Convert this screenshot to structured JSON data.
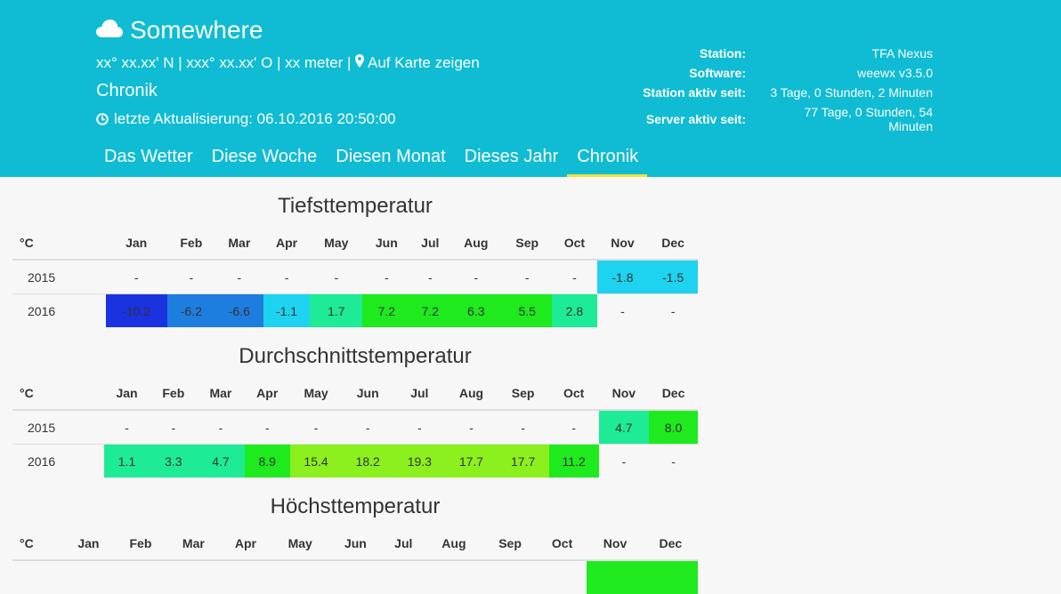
{
  "header": {
    "site_name": "Somewhere",
    "location": "xx° xx.xx' N | xxx° xx.xx' O | xx meter |",
    "map_link": "Auf Karte zeigen",
    "page_title": "Chronik",
    "last_update": "letzte Aktualisierung: 06.10.2016 20:50:00",
    "icons": {
      "site": "cloud-icon",
      "map": "map-marker-icon",
      "update": "clock-icon"
    }
  },
  "station_info": [
    {
      "label": "Station:",
      "value": "TFA Nexus"
    },
    {
      "label": "Software:",
      "value": "weewx v3.5.0"
    },
    {
      "label": "Station aktiv seit:",
      "value": "3 Tage, 0 Stunden, 2 Minuten"
    },
    {
      "label": "Server aktiv seit:",
      "value": "77 Tage, 0 Stunden, 54 Minuten"
    }
  ],
  "nav": {
    "tabs": [
      "Das Wetter",
      "Diese Woche",
      "Diesen Monat",
      "Dieses Jahr",
      "Chronik"
    ],
    "active": "Chronik"
  },
  "colors": {
    "header_bg": "#0fbcd4",
    "active_tab_underline": "#f3e33c",
    "temp_scale": {
      "-10.2": "#1a32e0",
      "-6": "#1e7ee0",
      "-2": "#1ed3ef",
      "2": "#1eeb96",
      "6": "#1eea1e",
      "15": "#8cf01e"
    }
  },
  "tables": [
    {
      "title": "Tiefsttemperatur",
      "unit": "°C",
      "months": [
        "Jan",
        "Feb",
        "Mar",
        "Apr",
        "May",
        "Jun",
        "Jul",
        "Aug",
        "Sep",
        "Oct",
        "Nov",
        "Dec"
      ],
      "rows": [
        {
          "year": "2015",
          "values": [
            "-",
            "-",
            "-",
            "-",
            "-",
            "-",
            "-",
            "-",
            "-",
            "-",
            "-1.8",
            "-1.5"
          ],
          "colors": [
            "",
            "",
            "",
            "",
            "",
            "",
            "",
            "",
            "",
            "",
            "#1ed3ef",
            "#1ed3ef"
          ]
        },
        {
          "year": "2016",
          "values": [
            "-10.2",
            "-6.2",
            "-6.6",
            "-1.1",
            "1.7",
            "7.2",
            "7.2",
            "6.3",
            "5.5",
            "2.8",
            "-",
            "-"
          ],
          "colors": [
            "#1a32e0",
            "#1e7ee0",
            "#1e7ee0",
            "#1ed3ef",
            "#1eeb96",
            "#1eea1e",
            "#1eea1e",
            "#1eea1e",
            "#1eea1e",
            "#1eeb96",
            "",
            ""
          ]
        }
      ]
    },
    {
      "title": "Durchschnittstemperatur",
      "unit": "°C",
      "months": [
        "Jan",
        "Feb",
        "Mar",
        "Apr",
        "May",
        "Jun",
        "Jul",
        "Aug",
        "Sep",
        "Oct",
        "Nov",
        "Dec"
      ],
      "rows": [
        {
          "year": "2015",
          "values": [
            "-",
            "-",
            "-",
            "-",
            "-",
            "-",
            "-",
            "-",
            "-",
            "-",
            "4.7",
            "8.0"
          ],
          "colors": [
            "",
            "",
            "",
            "",
            "",
            "",
            "",
            "",
            "",
            "",
            "#1eeb96",
            "#1eea1e"
          ]
        },
        {
          "year": "2016",
          "values": [
            "1.1",
            "3.3",
            "4.7",
            "8.9",
            "15.4",
            "18.2",
            "19.3",
            "17.7",
            "17.7",
            "11.2",
            "-",
            "-"
          ],
          "colors": [
            "#1eeb96",
            "#1eeb96",
            "#1eeb96",
            "#1eea1e",
            "#8cf01e",
            "#8cf01e",
            "#8cf01e",
            "#8cf01e",
            "#8cf01e",
            "#1eea1e",
            "",
            ""
          ]
        }
      ]
    },
    {
      "title": "Höchsttemperatur",
      "unit": "°C",
      "months": [
        "Jan",
        "Feb",
        "Mar",
        "Apr",
        "May",
        "Jun",
        "Jul",
        "Aug",
        "Sep",
        "Oct",
        "Nov",
        "Dec"
      ],
      "rows": [
        {
          "year": "",
          "values": [
            "",
            "",
            "",
            "",
            "",
            "",
            "",
            "",
            "",
            "",
            "",
            ""
          ],
          "colors": [
            "",
            "",
            "",
            "",
            "",
            "",
            "",
            "",
            "",
            "",
            "#1eea1e",
            "#1eea1e"
          ]
        }
      ]
    }
  ]
}
